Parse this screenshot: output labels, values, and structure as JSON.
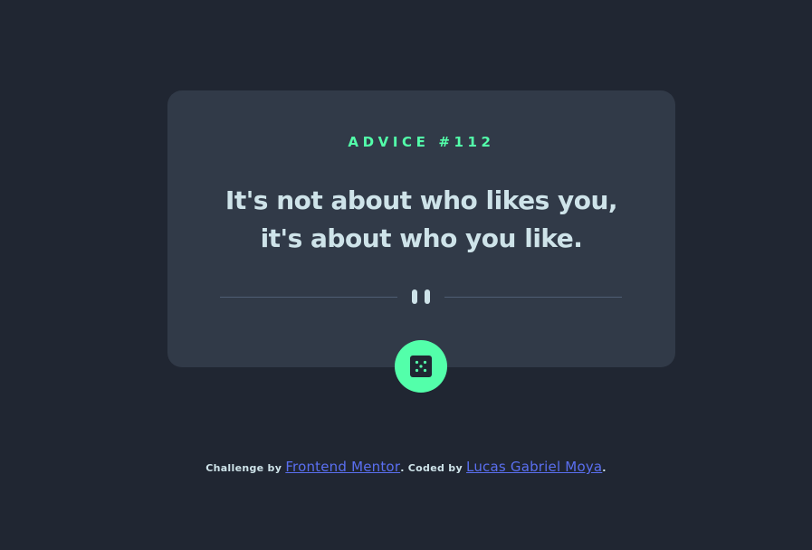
{
  "card": {
    "advice_label": "ADVICE #112",
    "advice_text": "It's not about who likes you, it's about who you like."
  },
  "icons": {
    "divider": "pause-icon",
    "generate": "dice-icon"
  },
  "attribution": {
    "challenge_prefix": "Challenge by ",
    "challenge_link": "Frontend Mentor",
    "coded_prefix": ". Coded by ",
    "coded_link": "Lucas Gabriel Moya",
    "suffix": "."
  },
  "colors": {
    "background": "#202632",
    "card": "#313a48",
    "accent_green": "#53ffaa",
    "text_light": "#cee3e9",
    "link_blue": "#5a6ff0",
    "divider": "#4f5d74"
  }
}
